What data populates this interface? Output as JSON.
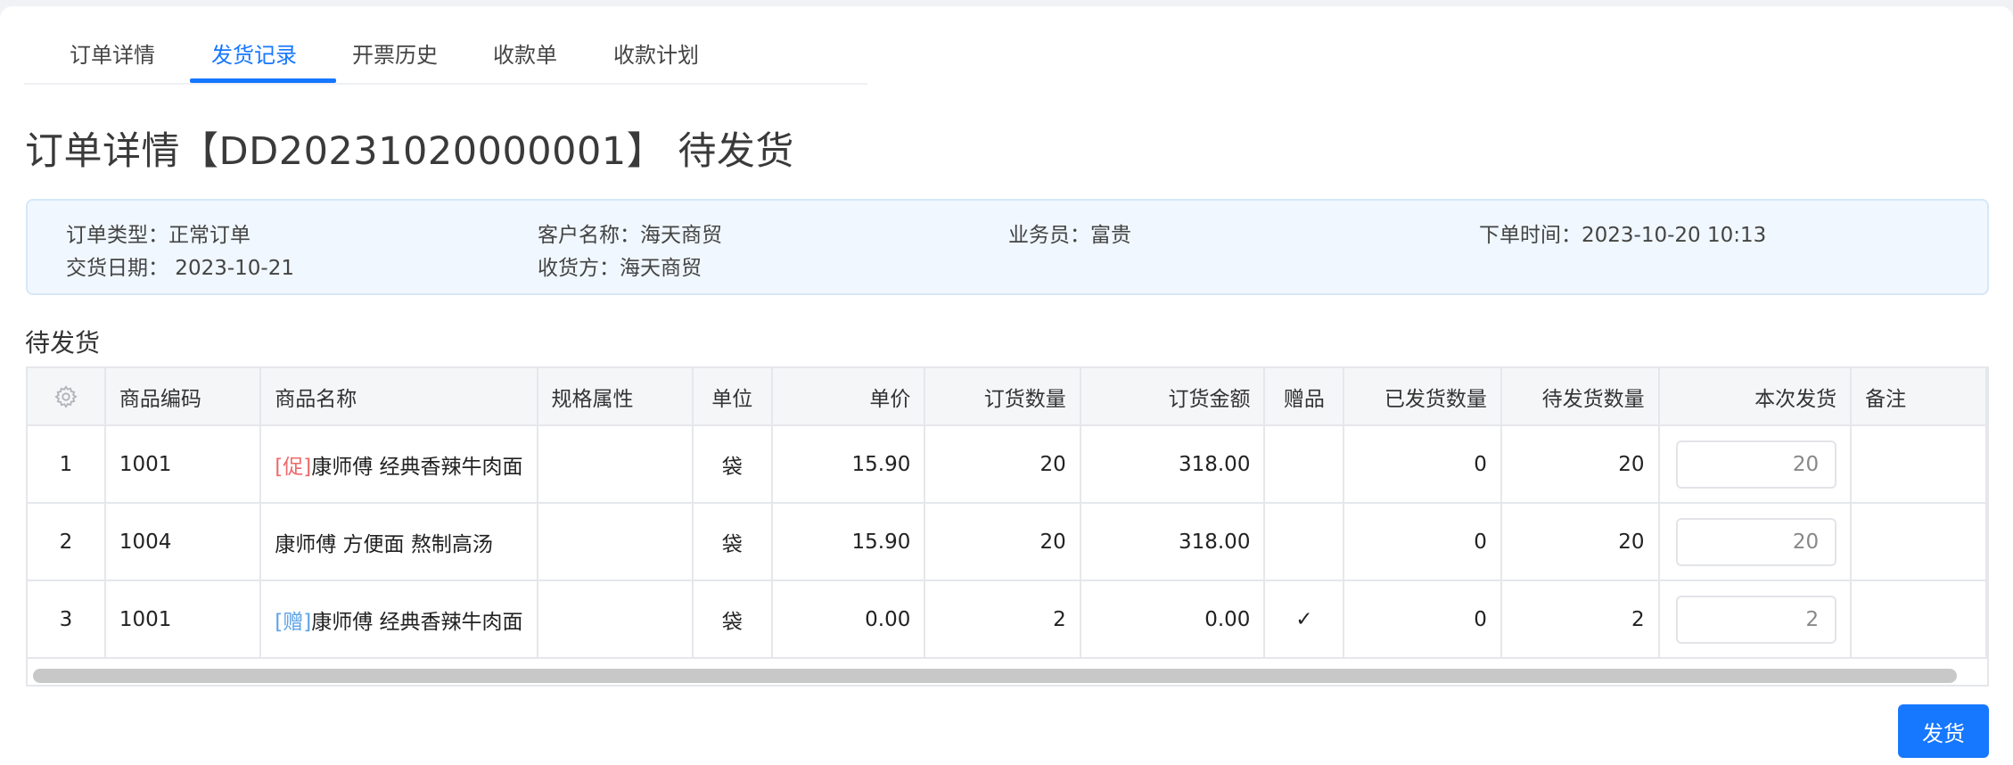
{
  "tabs": [
    {
      "label": "订单详情",
      "active": false
    },
    {
      "label": "发货记录",
      "active": true
    },
    {
      "label": "开票历史",
      "active": false
    },
    {
      "label": "收款单",
      "active": false
    },
    {
      "label": "收款计划",
      "active": false
    }
  ],
  "page_title": "订单详情【DD20231020000001】 待发货",
  "info": {
    "order_type": "订单类型：正常订单",
    "customer": "客户名称：海天商贸",
    "salesperson": "业务员：富贵",
    "order_time": "下单时间：2023-10-20 10:13",
    "delivery_date": "交货日期： 2023-10-21",
    "consignee": "收货方：海天商贸"
  },
  "section_title": "待发货",
  "table": {
    "headers": {
      "code": "商品编码",
      "name": "商品名称",
      "spec": "规格属性",
      "unit": "单位",
      "price": "单价",
      "qty": "订货数量",
      "amount": "订货金额",
      "gift": "赠品",
      "shipped": "已发货数量",
      "pending": "待发货数量",
      "current": "本次发货",
      "remark": "备注"
    },
    "rows": [
      {
        "index": "1",
        "code": "1001",
        "tag": "[促]",
        "name": "康师傅 经典香辣牛肉面",
        "spec": "",
        "unit": "袋",
        "price": "15.90",
        "qty": "20",
        "amount": "318.00",
        "gift": "",
        "shipped": "0",
        "pending": "20",
        "current": "20",
        "remark": ""
      },
      {
        "index": "2",
        "code": "1004",
        "tag": "",
        "name": "康师傅 方便面 熬制高汤",
        "spec": "",
        "unit": "袋",
        "price": "15.90",
        "qty": "20",
        "amount": "318.00",
        "gift": "",
        "shipped": "0",
        "pending": "20",
        "current": "20",
        "remark": ""
      },
      {
        "index": "3",
        "code": "1001",
        "tag": "[赠]",
        "name": "康师傅 经典香辣牛肉面",
        "spec": "",
        "unit": "袋",
        "price": "0.00",
        "qty": "2",
        "amount": "0.00",
        "gift": "✓",
        "shipped": "0",
        "pending": "2",
        "current": "2",
        "remark": ""
      }
    ]
  },
  "ship_button": "发货",
  "colors": {
    "accent": "#1677ff",
    "promo_tag": "#ee6a6a",
    "gift_tag": "#5ea3e6"
  }
}
